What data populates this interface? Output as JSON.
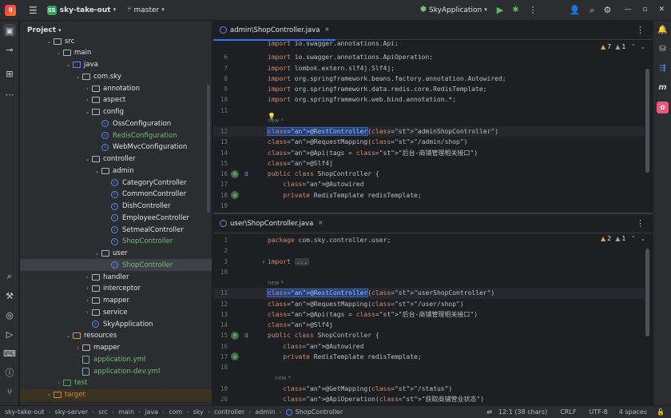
{
  "titlebar": {
    "project_badge": "SS",
    "project_name": "sky-take-out",
    "branch": "master",
    "run_config": "SkyApplication"
  },
  "project_panel": {
    "title": "Project",
    "tree": [
      {
        "label": "src",
        "indent": 3,
        "type": "folder",
        "open": true
      },
      {
        "label": "main",
        "indent": 4,
        "type": "folder",
        "open": true
      },
      {
        "label": "java",
        "indent": 5,
        "type": "folder-src",
        "open": true
      },
      {
        "label": "com.sky",
        "indent": 6,
        "type": "folder",
        "open": true
      },
      {
        "label": "annotation",
        "indent": 7,
        "type": "folder",
        "open": false
      },
      {
        "label": "aspect",
        "indent": 7,
        "type": "folder",
        "open": false
      },
      {
        "label": "config",
        "indent": 7,
        "type": "folder",
        "open": true
      },
      {
        "label": "OssConfiguration",
        "indent": 8,
        "type": "class",
        "leaf": true
      },
      {
        "label": "RedisConfiguration",
        "indent": 8,
        "type": "class",
        "leaf": true,
        "green": true
      },
      {
        "label": "WebMvcConfiguration",
        "indent": 8,
        "type": "class",
        "leaf": true
      },
      {
        "label": "controller",
        "indent": 7,
        "type": "folder",
        "open": true
      },
      {
        "label": "admin",
        "indent": 8,
        "type": "folder",
        "open": true
      },
      {
        "label": "CategoryController",
        "indent": 9,
        "type": "class",
        "leaf": true
      },
      {
        "label": "CommonController",
        "indent": 9,
        "type": "class",
        "leaf": true
      },
      {
        "label": "DishController",
        "indent": 9,
        "type": "class",
        "leaf": true
      },
      {
        "label": "EmployeeController",
        "indent": 9,
        "type": "class",
        "leaf": true
      },
      {
        "label": "SetmealController",
        "indent": 9,
        "type": "class",
        "leaf": true
      },
      {
        "label": "ShopController",
        "indent": 9,
        "type": "class",
        "leaf": true,
        "green": true
      },
      {
        "label": "user",
        "indent": 8,
        "type": "folder",
        "open": true
      },
      {
        "label": "ShopController",
        "indent": 9,
        "type": "class",
        "leaf": true,
        "green": true,
        "selected": true
      },
      {
        "label": "handler",
        "indent": 7,
        "type": "folder",
        "open": false
      },
      {
        "label": "interceptor",
        "indent": 7,
        "type": "folder",
        "open": false
      },
      {
        "label": "mapper",
        "indent": 7,
        "type": "folder",
        "open": false
      },
      {
        "label": "service",
        "indent": 7,
        "type": "folder",
        "open": false
      },
      {
        "label": "SkyApplication",
        "indent": 7,
        "type": "class",
        "leaf": true
      },
      {
        "label": "resources",
        "indent": 5,
        "type": "folder-res",
        "open": true
      },
      {
        "label": "mapper",
        "indent": 6,
        "type": "folder",
        "open": false
      },
      {
        "label": "application.yml",
        "indent": 6,
        "type": "yml",
        "leaf": true,
        "green": true
      },
      {
        "label": "application-dev.yml",
        "indent": 6,
        "type": "yml",
        "leaf": true,
        "green": true
      },
      {
        "label": "test",
        "indent": 4,
        "type": "folder-test",
        "open": false,
        "green": true
      },
      {
        "label": "target",
        "indent": 3,
        "type": "folder-tgt",
        "open": false,
        "orange": true
      }
    ]
  },
  "editor_top": {
    "tab": "admin\\ShopController.java",
    "warnings": "7",
    "weak_warnings": "1",
    "lines": [
      {
        "n": "",
        "code": "import io.swagger.annotations.Api;",
        "partial": true
      },
      {
        "n": "6",
        "code": "import io.swagger.annotations.ApiOperation;"
      },
      {
        "n": "7",
        "code": "import lombok.extern.slf4j.Slf4j;"
      },
      {
        "n": "8",
        "code": "import org.springframework.beans.factory.annotation.Autowired;"
      },
      {
        "n": "9",
        "code": "import org.springframework.data.redis.core.RedisTemplate;"
      },
      {
        "n": "10",
        "code": "import org.springframework.web.bind.annotation.*;"
      },
      {
        "n": "11",
        "code": ""
      },
      {
        "n": "",
        "code": "new *",
        "hint": true
      },
      {
        "n": "12",
        "code": "@RestController(\"adminShopController\")",
        "current": true
      },
      {
        "n": "13",
        "code": "@RequestMapping(\"/admin/shop\")"
      },
      {
        "n": "14",
        "code": "@Api(tags = \"后台-商铺管理相关接口\")"
      },
      {
        "n": "15",
        "code": "@Slf4j"
      },
      {
        "n": "16",
        "code": "public class ShopController {"
      },
      {
        "n": "17",
        "code": "    @Autowired"
      },
      {
        "n": "18",
        "code": "    private RedisTemplate redisTemplate;"
      },
      {
        "n": "19",
        "code": ""
      },
      {
        "n": "",
        "code": "    /**"
      }
    ]
  },
  "editor_bottom": {
    "tab": "user\\ShopController.java",
    "warnings": "2",
    "weak_warnings": "1",
    "lines": [
      {
        "n": "1",
        "code": "package com.sky.controller.user;"
      },
      {
        "n": "2",
        "code": ""
      },
      {
        "n": "3",
        "code": "import ..."
      },
      {
        "n": "10",
        "code": ""
      },
      {
        "n": "",
        "code": "new *",
        "hint": true
      },
      {
        "n": "11",
        "code": "@RestController(\"userShopController\")",
        "current": true
      },
      {
        "n": "12",
        "code": "@RequestMapping(\"/user/shop\")"
      },
      {
        "n": "13",
        "code": "@Api(tags = \"后台-商铺管理相关接口\")"
      },
      {
        "n": "14",
        "code": "@Slf4j"
      },
      {
        "n": "15",
        "code": "public class ShopController {"
      },
      {
        "n": "16",
        "code": "    @Autowired"
      },
      {
        "n": "17",
        "code": "    private RedisTemplate redisTemplate;"
      },
      {
        "n": "18",
        "code": ""
      },
      {
        "n": "",
        "code": "    new *",
        "hint": true
      },
      {
        "n": "19",
        "code": "    @GetMapping(\"/status\")"
      },
      {
        "n": "20",
        "code": "    @ApiOperation(\"获取商铺营业状态\")"
      }
    ]
  },
  "statusbar": {
    "breadcrumbs": [
      "sky-take-out",
      "sky-server",
      "src",
      "main",
      "java",
      "com",
      "sky",
      "controller",
      "admin",
      "ShopController"
    ],
    "position": "12:1 (38 chars)",
    "line_sep": "CRLF",
    "encoding": "UTF-8",
    "indent": "4 spaces"
  }
}
